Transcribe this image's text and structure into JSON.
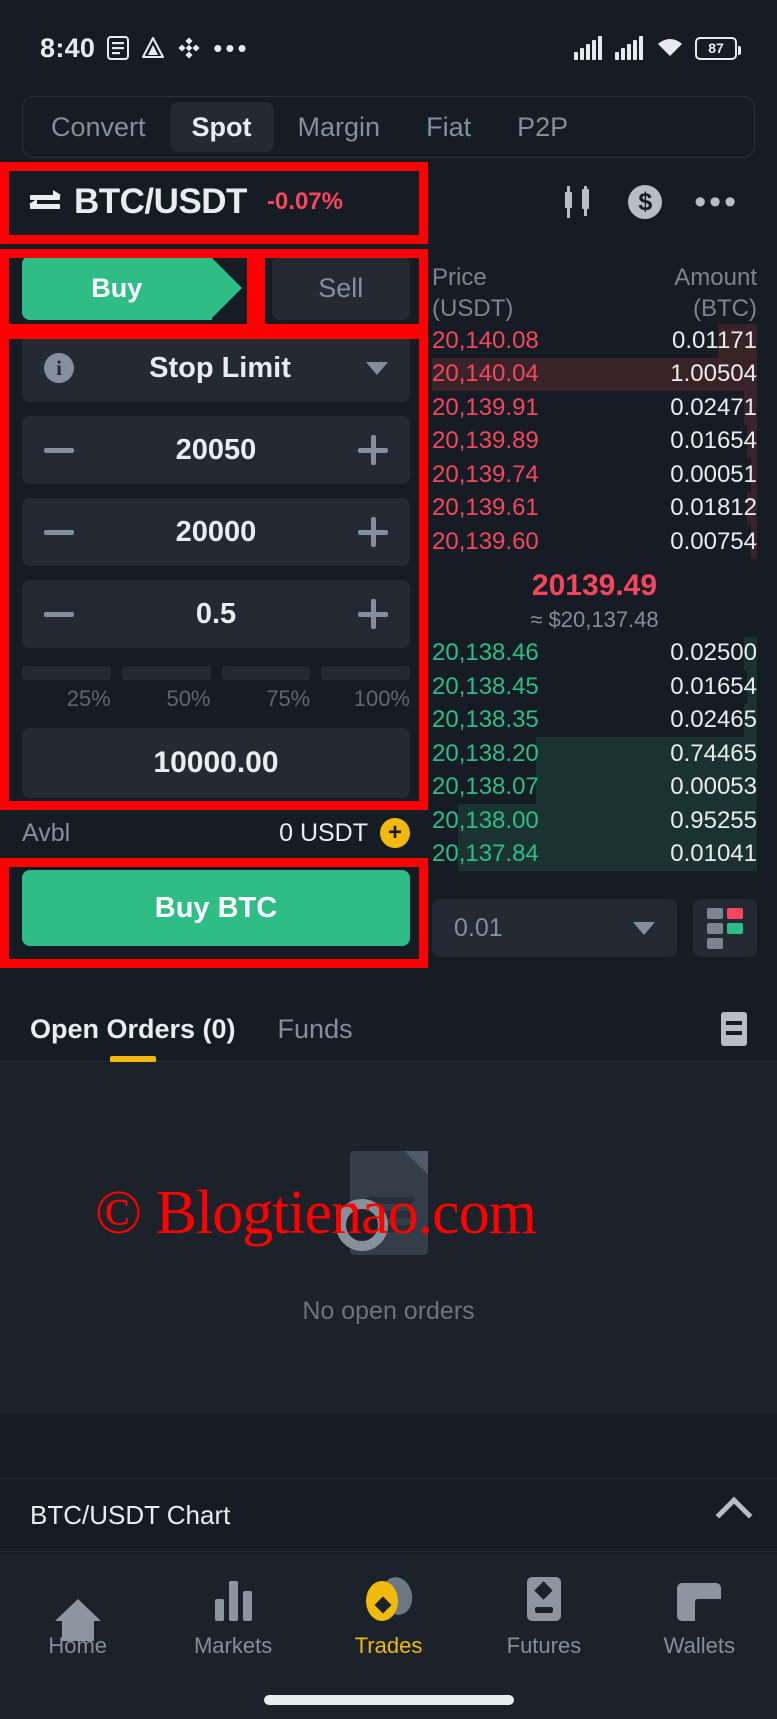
{
  "status_bar": {
    "time": "8:40",
    "battery": "87",
    "icons": [
      "notes-icon",
      "drive-icon",
      "binance-icon",
      "overflow-dots-icon",
      "signal-icon",
      "signal2-icon",
      "wifi-icon",
      "battery-icon"
    ]
  },
  "top_tabs": {
    "items": [
      {
        "label": "Convert",
        "active": false
      },
      {
        "label": "Spot",
        "active": true
      },
      {
        "label": "Margin",
        "active": false
      },
      {
        "label": "Fiat",
        "active": false
      },
      {
        "label": "P2P",
        "active": false
      }
    ]
  },
  "pair_header": {
    "pair": "BTC/USDT",
    "change": "-0.07%",
    "change_color": "#f6465d"
  },
  "side_tabs": {
    "buy": "Buy",
    "sell": "Sell",
    "buy_color": "#2ebd85"
  },
  "order_form": {
    "order_type": "Stop Limit",
    "stop_price": "20050",
    "limit_price": "20000",
    "amount": "0.5",
    "percents": [
      "25%",
      "50%",
      "75%",
      "100%"
    ],
    "total": "10000.00",
    "available_label": "Avbl",
    "available_value": "0 USDT",
    "submit_label": "Buy BTC"
  },
  "order_book": {
    "header_price": "Price",
    "header_price_unit": "(USDT)",
    "header_amount": "Amount",
    "header_amount_unit": "(BTC)",
    "asks": [
      {
        "price": "20,140.08",
        "amount": "0.01171",
        "depth": 12
      },
      {
        "price": "20,140.04",
        "amount": "1.00504",
        "depth": 100
      },
      {
        "price": "20,139.91",
        "amount": "0.02471",
        "depth": 4
      },
      {
        "price": "20,139.89",
        "amount": "0.01654",
        "depth": 3
      },
      {
        "price": "20,139.74",
        "amount": "0.00051",
        "depth": 2
      },
      {
        "price": "20,139.61",
        "amount": "0.01812",
        "depth": 3
      },
      {
        "price": "20,139.60",
        "amount": "0.00754",
        "depth": 2
      }
    ],
    "mid_price": "20139.49",
    "mid_price_usd": "≈ $20,137.48",
    "bids": [
      {
        "price": "20,138.46",
        "amount": "0.02500",
        "depth": 4
      },
      {
        "price": "20,138.45",
        "amount": "0.01654",
        "depth": 3
      },
      {
        "price": "20,138.35",
        "amount": "0.02465",
        "depth": 4
      },
      {
        "price": "20,138.20",
        "amount": "0.74465",
        "depth": 68
      },
      {
        "price": "20,138.07",
        "amount": "0.00053",
        "depth": 2
      },
      {
        "price": "20,138.00",
        "amount": "0.95255",
        "depth": 88
      },
      {
        "price": "20,137.84",
        "amount": "0.01041",
        "depth": 88
      }
    ],
    "tick_size": "0.01",
    "depth_view_icon": "depth-layout-icon"
  },
  "orders_section": {
    "tabs": [
      {
        "label": "Open Orders (0)",
        "active": true
      },
      {
        "label": "Funds",
        "active": false
      }
    ],
    "empty_text": "No open orders",
    "accent": "#f0b90b"
  },
  "watermark": {
    "text": "Blogtienao.com",
    "mark": "©",
    "color": "#ff0000"
  },
  "chart_row": {
    "label": "BTC/USDT Chart"
  },
  "bottom_nav": {
    "items": [
      {
        "label": "Home",
        "icon": "home-icon",
        "active": false
      },
      {
        "label": "Markets",
        "icon": "bars-icon",
        "active": false
      },
      {
        "label": "Trades",
        "icon": "trades-icon",
        "active": true
      },
      {
        "label": "Futures",
        "icon": "futures-icon",
        "active": false
      },
      {
        "label": "Wallets",
        "icon": "wallet-icon",
        "active": false
      }
    ]
  }
}
